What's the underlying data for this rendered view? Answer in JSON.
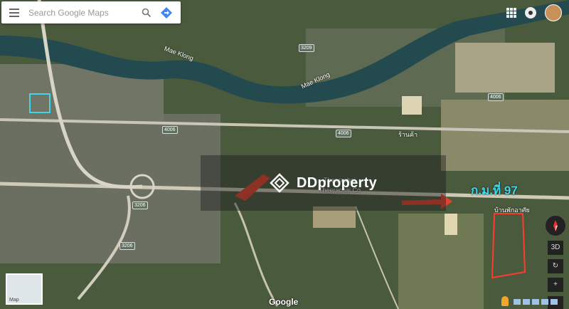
{
  "search": {
    "placeholder": "Search Google Maps"
  },
  "labels": {
    "river_1": "Mae Klong",
    "river_2": "Mae Klong",
    "theerachai": "Theerachai",
    "theerachai_2": "Theerachai Co.",
    "thai_place_1": "ร้านค้า",
    "thai_place_2": "บ้านพักอาศัย"
  },
  "watermark": {
    "brand": "DDproperty"
  },
  "annotation": {
    "km_marker": "ก.ม.ที่ 97"
  },
  "attribution": {
    "google": "Google"
  },
  "map_thumb": {
    "label": "Map"
  },
  "controls": {
    "three_d": "3D"
  },
  "road_shields": [
    "3209",
    "4006",
    "4006",
    "4006",
    "3206",
    "3206"
  ],
  "colors": {
    "parcel_outline": "#ff3b2f",
    "highlight_cyan": "#3fd6e8",
    "arrow_red": "#e8412b"
  }
}
